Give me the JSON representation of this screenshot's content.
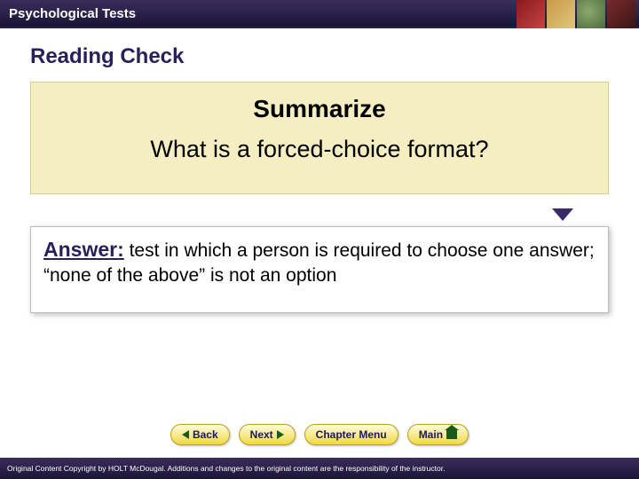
{
  "header": {
    "title": "Psychological Tests"
  },
  "section": {
    "title": "Reading Check"
  },
  "question": {
    "heading": "Summarize",
    "text": "What is a forced-choice format?"
  },
  "answer": {
    "label": "Answer:",
    "text": " test in which a person is required to choose one answer; “none of the above” is not an option"
  },
  "nav": {
    "back": "Back",
    "next": "Next",
    "menu": "Chapter Menu",
    "main": "Main"
  },
  "footer": {
    "text": "Original Content Copyright by HOLT McDougal. Additions and changes to the original content are the responsibility of the instructor."
  }
}
